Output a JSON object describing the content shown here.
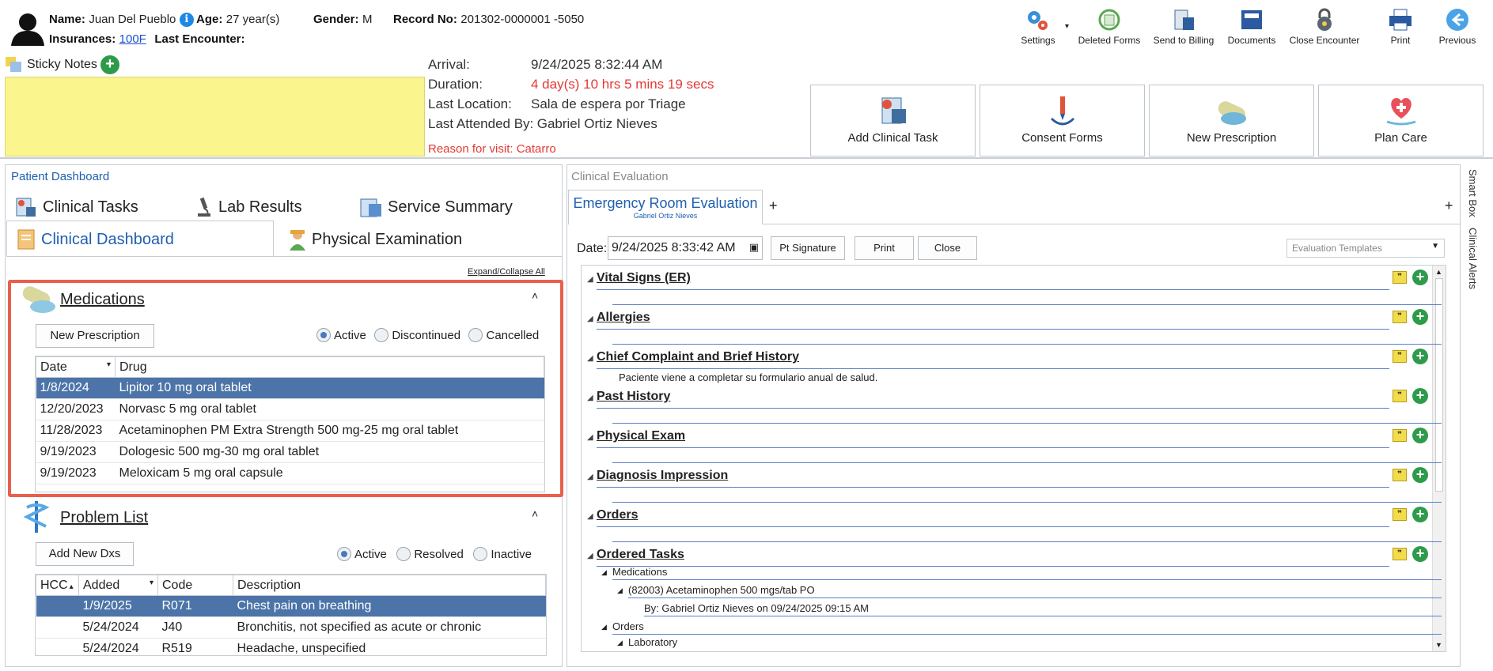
{
  "header": {
    "name_label": "Name:",
    "name_value": "Juan Del Pueblo",
    "info_icon": "i",
    "age_label": "Age:",
    "age_value": "27 year(s)",
    "gender_label": "Gender:",
    "gender_value": "M",
    "record_label": "Record No:",
    "record_value": "201302-0000001 -5050",
    "insurances_label": "Insurances:",
    "insurances_value": "100F",
    "last_encounter_label": "Last Encounter:"
  },
  "toolbar": [
    {
      "label": "Settings",
      "icon": "gears-icon"
    },
    {
      "label": "Deleted Forms",
      "icon": "recycle-icon"
    },
    {
      "label": "Send to Billing",
      "icon": "billing-icon"
    },
    {
      "label": "Documents",
      "icon": "documents-icon"
    },
    {
      "label": "Close Encounter",
      "icon": "lock-icon"
    },
    {
      "label": "Print",
      "icon": "printer-icon"
    },
    {
      "label": "Previous",
      "icon": "back-arrow-icon"
    }
  ],
  "sticky": {
    "label": "Sticky Notes"
  },
  "visit": {
    "arrival_label": "Arrival:",
    "arrival_value": "9/24/2025 8:32:44 AM",
    "duration_label": "Duration:",
    "duration_value": "4 day(s) 10 hrs 5 mins 19 secs",
    "last_location_label": "Last Location:",
    "last_location_value": "Sala de espera por Triage",
    "last_attended_label": "Last Attended By:",
    "last_attended_value": "Gabriel Ortiz Nieves",
    "reason": "Reason for visit: Catarro"
  },
  "actions": [
    {
      "label": "Add Clinical Task"
    },
    {
      "label": "Consent Forms"
    },
    {
      "label": "New Prescription"
    },
    {
      "label": "Plan Care"
    }
  ],
  "left_panel": {
    "title": "Patient Dashboard",
    "tabs": [
      "Clinical Tasks",
      "Lab Results",
      "Service Summary",
      "Clinical Dashboard",
      "Physical Examination"
    ],
    "expand_collapse": "Expand/Collapse All"
  },
  "medications": {
    "title": "Medications",
    "new_button": "New Prescription",
    "filters": [
      "Active",
      "Discontinued",
      "Cancelled"
    ],
    "columns": [
      "Date",
      "Drug"
    ],
    "rows": [
      [
        "1/8/2024",
        "Lipitor 10 mg oral tablet"
      ],
      [
        "12/20/2023",
        "Norvasc 5 mg oral tablet"
      ],
      [
        "11/28/2023",
        "Acetaminophen PM Extra Strength 500 mg-25 mg oral tablet"
      ],
      [
        "9/19/2023",
        "Dologesic 500 mg-30 mg oral tablet"
      ],
      [
        "9/19/2023",
        "Meloxicam 5 mg oral capsule"
      ]
    ]
  },
  "problems": {
    "title": "Problem List",
    "new_button": "Add New Dxs",
    "filters": [
      "Active",
      "Resolved",
      "Inactive"
    ],
    "columns": [
      "HCC",
      "Added",
      "Code",
      "Description"
    ],
    "rows": [
      [
        "",
        "1/9/2025",
        "R071",
        "Chest pain on breathing"
      ],
      [
        "",
        "5/24/2024",
        "J40",
        "Bronchitis, not specified as acute or chronic"
      ],
      [
        "",
        "5/24/2024",
        "R519",
        "Headache, unspecified"
      ]
    ]
  },
  "right_panel": {
    "title": "Clinical Evaluation",
    "tab_title": "Emergency Room Evaluation",
    "tab_sub": "Gabriel Ortiz Nieves",
    "add_tab": "+",
    "date_label": "Date:",
    "date_value": "9/24/2025 8:33:42 AM",
    "pt_signature": "Pt Signature",
    "print": "Print",
    "close": "Close",
    "templates_placeholder": "Evaluation Templates",
    "sections": [
      {
        "title": "Vital Signs (ER)"
      },
      {
        "title": "Allergies"
      },
      {
        "title": "Chief Complaint and Brief History",
        "note": "Paciente viene a completar su formulario anual de salud."
      },
      {
        "title": "Past History"
      },
      {
        "title": "Physical Exam"
      },
      {
        "title": "Diagnosis Impression"
      },
      {
        "title": "Orders"
      },
      {
        "title": "Ordered Tasks"
      }
    ],
    "ordered_tasks": {
      "medications_label": "Medications",
      "med_item": "(82003) Acetaminophen 500 mgs/tab PO",
      "med_by": "By: Gabriel Ortiz Nieves on 09/24/2025 09:15 AM",
      "orders_label": "Orders",
      "lab_label": "Laboratory"
    }
  },
  "side_tabs": [
    "Smart Box",
    "Clinical Alerts"
  ]
}
